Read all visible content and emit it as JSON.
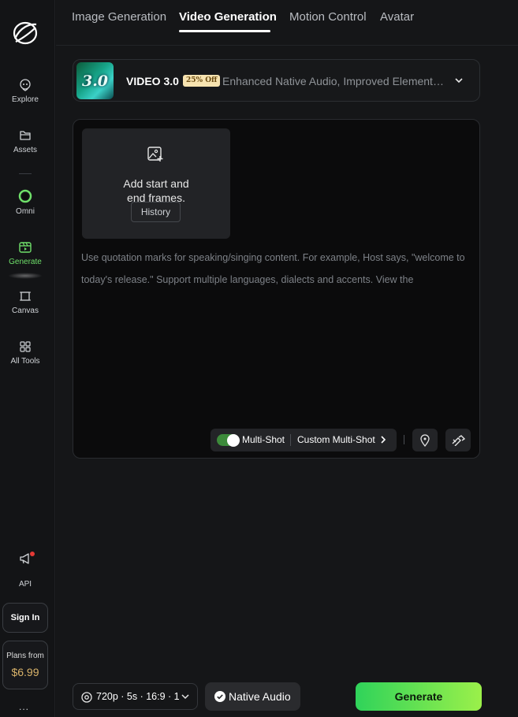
{
  "sidebar": {
    "items": [
      {
        "label": "Explore"
      },
      {
        "label": "Assets"
      },
      {
        "label": "Omni"
      },
      {
        "label": "Generate"
      },
      {
        "label": "Canvas"
      },
      {
        "label": "All Tools"
      }
    ],
    "api_label": "API",
    "sign_in_label": "Sign In",
    "plans_label": "Plans from",
    "plans_price": "$6.99",
    "more_label": "..."
  },
  "tabs": [
    {
      "label": "Image Generation"
    },
    {
      "label": "Video Generation",
      "active": true
    },
    {
      "label": "Motion Control"
    },
    {
      "label": "Avatar"
    }
  ],
  "model": {
    "thumb_text": "3.0",
    "name": "VIDEO 3.0",
    "badge": "25% Off",
    "description": "Enhanced Native Audio, Improved Element Consistency"
  },
  "frames": {
    "text_line1": "Add start and",
    "text_line2": "end frames.",
    "history_label": "History"
  },
  "prompt": {
    "placeholder": "Use quotation marks for speaking/singing content. For example, Host says, \"welcome to today's release.\" Support multiple languages, dialects and accents. View the"
  },
  "toolbar": {
    "multishot_label": "Multi-Shot",
    "multishot_enabled": true,
    "custom_multishot_label": "Custom Multi-Shot"
  },
  "bottom": {
    "settings_summary": "720p · 5s · 16:9 · 1",
    "native_audio_label": "Native Audio",
    "generate_label": "Generate"
  },
  "colors": {
    "accent_green": "#6fe06a",
    "badge_bg": "#f7e3b0",
    "price_gold": "#d9b36a",
    "generate_gradient_start": "#2fd35a",
    "generate_gradient_end": "#9bf04a"
  }
}
